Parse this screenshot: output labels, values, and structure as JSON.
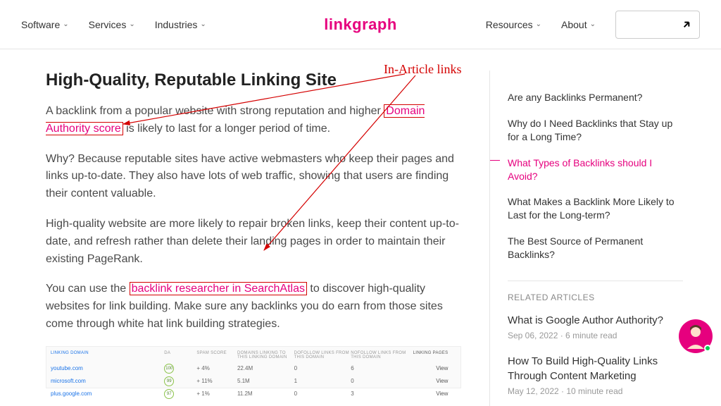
{
  "nav": {
    "left": [
      "Software",
      "Services",
      "Industries"
    ],
    "right": [
      "Resources",
      "About"
    ]
  },
  "logo": "linkgraph",
  "annotation_label": "In-Article links",
  "article": {
    "heading": "High-Quality, Reputable Linking Site",
    "p1_a": "A backlink from a popular website with strong reputation and higher ",
    "p1_link": "Domain Authority score",
    "p1_b": " is likely to last for a longer period of time.",
    "p2": "Why? Because reputable sites have active webmasters who keep their pages and links up-to-date. They also have lots of web traffic, showing that users are finding their content valuable.",
    "p3": "High-quality website are more likely to repair broken links, keep their content up-to-date, and refresh rather than delete their landing pages in order to maintain their existing PageRank.",
    "p4_a": "You can use the ",
    "p4_link": "backlink researcher in SearchAtlas",
    "p4_b": " to discover high-quality websites for link building. Make sure any backlinks you do earn from those sites come through white hat link building strategies."
  },
  "table": {
    "headers": [
      "LINKING DOMAIN",
      "DA",
      "SPAM SCORE",
      "DOMAINS LINKING TO THIS LINKING DOMAIN",
      "DOFOLLOW LINKS FROM THIS DOMAIN",
      "NOFOLLOW LINKS FROM THIS DOMAIN",
      "LINKING PAGES"
    ],
    "rows": [
      {
        "domain": "youtube.com",
        "da": "100",
        "spam": "+ 4%",
        "domains": "22.4M",
        "dofollow": "0",
        "nofollow": "6",
        "action": "View"
      },
      {
        "domain": "microsoft.com",
        "da": "99",
        "spam": "+ 11%",
        "domains": "5.1M",
        "dofollow": "1",
        "nofollow": "0",
        "action": "View"
      },
      {
        "domain": "plus.google.com",
        "da": "97",
        "spam": "+ 1%",
        "domains": "11.2M",
        "dofollow": "0",
        "nofollow": "3",
        "action": "View"
      }
    ]
  },
  "sidebar": {
    "toc": [
      {
        "label": "Are any Backlinks Permanent?",
        "active": false
      },
      {
        "label": "Why do I Need Backlinks that Stay up for a Long Time?",
        "active": false
      },
      {
        "label": "What Types of Backlinks should I Avoid?",
        "active": true
      },
      {
        "label": "What Makes a Backlink More Likely to Last for the Long-term?",
        "active": false
      },
      {
        "label": "The Best Source of Permanent Backlinks?",
        "active": false
      }
    ],
    "related_header": "RELATED ARTICLES",
    "related": [
      {
        "title": "What is Google Author Authority?",
        "meta": "Sep 06, 2022 · 6 minute read"
      },
      {
        "title": "How To Build High-Quality Links Through Content Marketing",
        "meta": "May 12, 2022 · 10 minute read"
      }
    ]
  }
}
